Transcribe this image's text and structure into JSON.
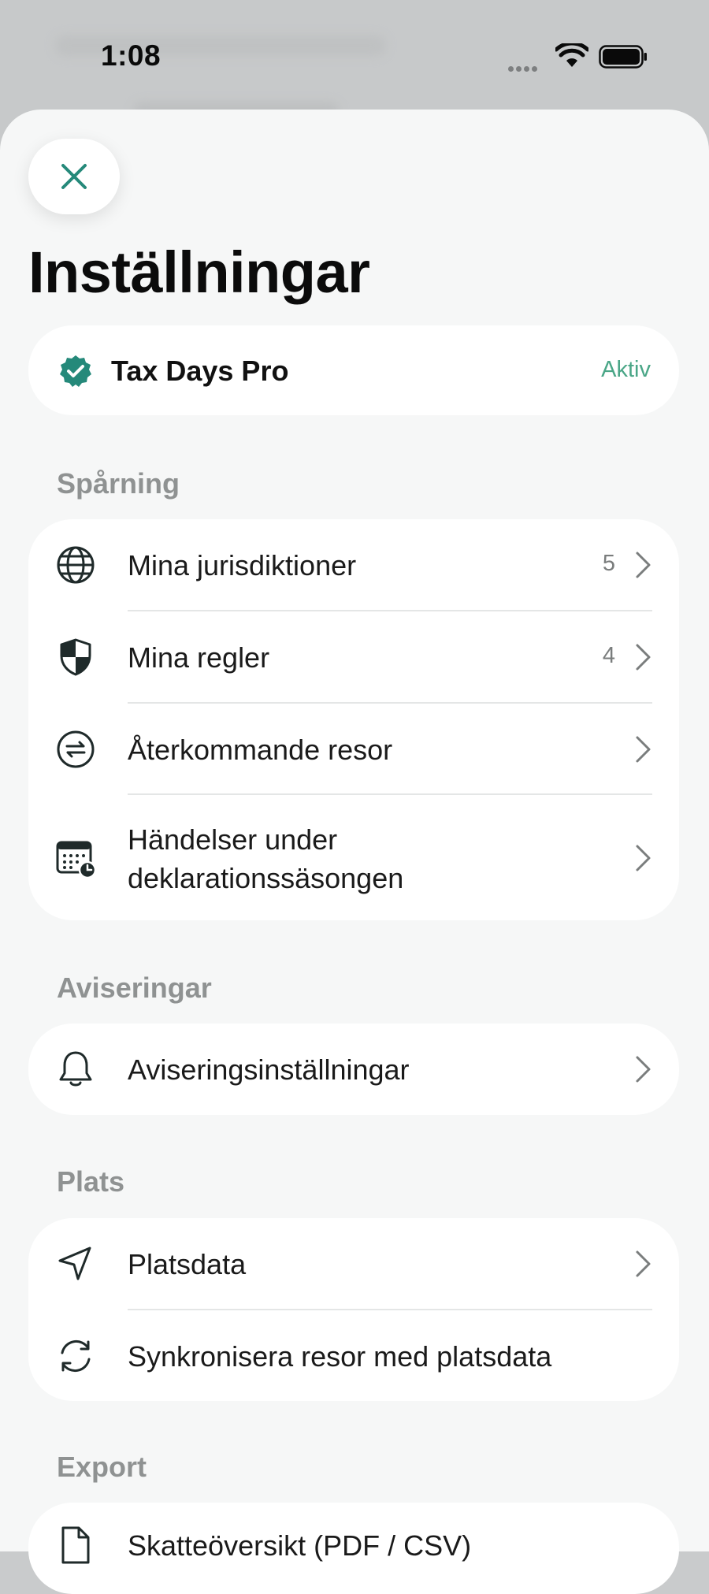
{
  "status_bar": {
    "time": "1:08"
  },
  "header": {
    "title": "Inställningar"
  },
  "subscription": {
    "name": "Tax Days Pro",
    "status": "Aktiv"
  },
  "sections": [
    {
      "label": "Spårning",
      "items": [
        {
          "label": "Mina jurisdiktioner",
          "count": "5",
          "icon": "globe-icon"
        },
        {
          "label": "Mina regler",
          "count": "4",
          "icon": "shield-icon"
        },
        {
          "label": "Återkommande resor",
          "icon": "repeat-icon"
        },
        {
          "label": "Händelser under deklarationssäsongen",
          "icon": "calendar-clock-icon"
        }
      ]
    },
    {
      "label": "Aviseringar",
      "items": [
        {
          "label": "Aviseringsinställningar",
          "icon": "bell-icon"
        }
      ]
    },
    {
      "label": "Plats",
      "items": [
        {
          "label": "Platsdata",
          "icon": "location-arrow-icon"
        },
        {
          "label": "Synkronisera resor med platsdata",
          "icon": "sync-icon"
        }
      ]
    },
    {
      "label": "Export",
      "items": [
        {
          "label": "Skatteöversikt (PDF / CSV)",
          "icon": "document-icon"
        }
      ]
    }
  ],
  "colors": {
    "accent": "#25897a",
    "status_green": "#4aa687",
    "sheet_bg": "#f6f7f7"
  }
}
